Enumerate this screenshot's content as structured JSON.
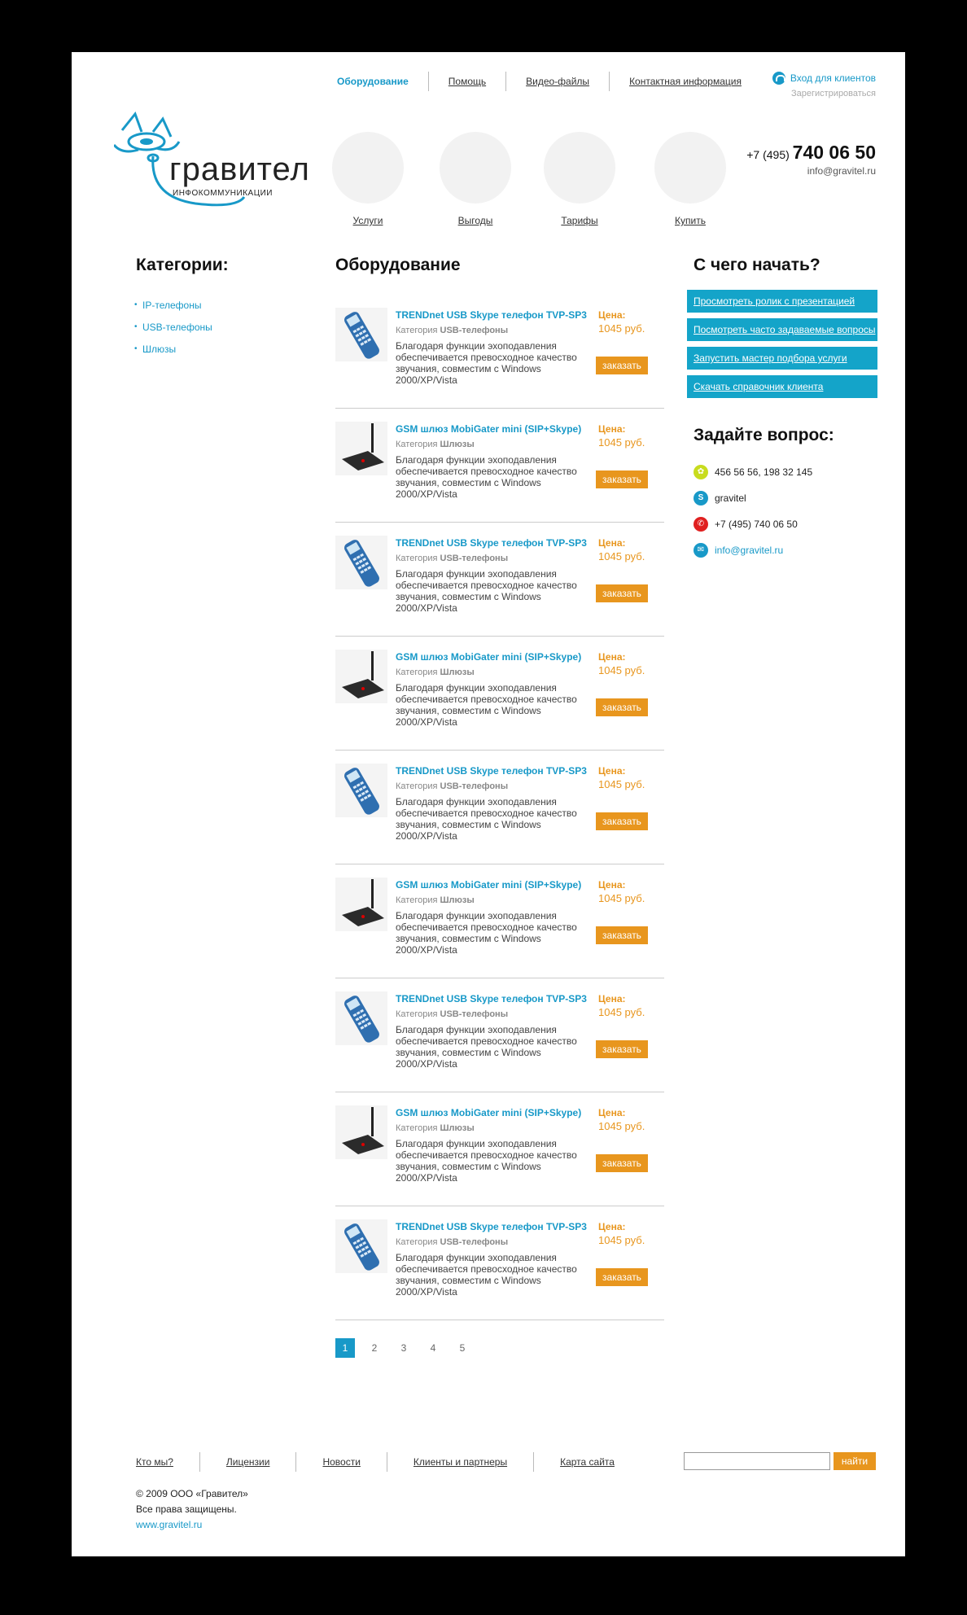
{
  "topnav": {
    "items": [
      "Оборудование",
      "Помощь",
      "Видео-файлы",
      "Контактная информация"
    ]
  },
  "login": {
    "enter": "Вход для клиентов",
    "register": "Зарегистрироваться"
  },
  "logo": {
    "name": "гравител",
    "sub": "ИНФОКОММУНИКАЦИИ"
  },
  "circles": [
    "Услуги",
    "Выгоды",
    "Тарифы",
    "Купить"
  ],
  "phone": {
    "prefix": "+7 (495)",
    "number": "740 06 50",
    "email": "info@gravitel.ru"
  },
  "left": {
    "title": "Категории:",
    "categories": [
      "IP-телефоны",
      "USB-телефоны",
      "Шлюзы"
    ]
  },
  "main": {
    "title": "Оборудование",
    "products": [
      {
        "kind": "phone",
        "title": "TRENDnet USB Skype телефон TVP-SP3",
        "cat_prefix": "Категория",
        "category": "USB-телефоны",
        "desc": "Благодаря функции эхоподавления обеспечивается превосходное качество звучания, совместим с Windows 2000/XP/Vista",
        "price_label": "Цена:",
        "price": "1045 руб.",
        "order": "заказать"
      },
      {
        "kind": "gateway",
        "title": "GSM шлюз MobiGater mini (SIP+Skype)",
        "cat_prefix": "Категория",
        "category": "Шлюзы",
        "desc": "Благодаря функции эхоподавления обеспечивается превосходное качество звучания, совместим с Windows 2000/XP/Vista",
        "price_label": "Цена:",
        "price": "1045 руб.",
        "order": "заказать"
      },
      {
        "kind": "phone",
        "title": "TRENDnet USB Skype телефон TVP-SP3",
        "cat_prefix": "Категория",
        "category": "USB-телефоны",
        "desc": "Благодаря функции эхоподавления обеспечивается превосходное качество звучания, совместим с Windows 2000/XP/Vista",
        "price_label": "Цена:",
        "price": "1045 руб.",
        "order": "заказать"
      },
      {
        "kind": "gateway",
        "title": "GSM шлюз MobiGater mini (SIP+Skype)",
        "cat_prefix": "Категория",
        "category": "Шлюзы",
        "desc": "Благодаря функции эхоподавления обеспечивается превосходное качество звучания, совместим с Windows 2000/XP/Vista",
        "price_label": "Цена:",
        "price": "1045 руб.",
        "order": "заказать"
      },
      {
        "kind": "phone",
        "title": "TRENDnet USB Skype телефон TVP-SP3",
        "cat_prefix": "Категория",
        "category": "USB-телефоны",
        "desc": "Благодаря функции эхоподавления обеспечивается превосходное качество звучания, совместим с Windows 2000/XP/Vista",
        "price_label": "Цена:",
        "price": "1045 руб.",
        "order": "заказать"
      },
      {
        "kind": "gateway",
        "title": "GSM шлюз MobiGater mini (SIP+Skype)",
        "cat_prefix": "Категория",
        "category": "Шлюзы",
        "desc": "Благодаря функции эхоподавления обеспечивается превосходное качество звучания, совместим с Windows 2000/XP/Vista",
        "price_label": "Цена:",
        "price": "1045 руб.",
        "order": "заказать"
      },
      {
        "kind": "phone",
        "title": "TRENDnet USB Skype телефон TVP-SP3",
        "cat_prefix": "Категория",
        "category": "USB-телефоны",
        "desc": "Благодаря функции эхоподавления обеспечивается превосходное качество звучания, совместим с Windows 2000/XP/Vista",
        "price_label": "Цена:",
        "price": "1045 руб.",
        "order": "заказать"
      },
      {
        "kind": "gateway",
        "title": "GSM шлюз MobiGater mini (SIP+Skype)",
        "cat_prefix": "Категория",
        "category": "Шлюзы",
        "desc": "Благодаря функции эхоподавления обеспечивается превосходное качество звучания, совместим с Windows 2000/XP/Vista",
        "price_label": "Цена:",
        "price": "1045 руб.",
        "order": "заказать"
      },
      {
        "kind": "phone",
        "title": "TRENDnet USB Skype телефон TVP-SP3",
        "cat_prefix": "Категория",
        "category": "USB-телефоны",
        "desc": "Благодаря функции эхоподавления обеспечивается превосходное качество звучания, совместим с Windows 2000/XP/Vista",
        "price_label": "Цена:",
        "price": "1045 руб.",
        "order": "заказать"
      }
    ],
    "pages": [
      "1",
      "2",
      "3",
      "4",
      "5"
    ]
  },
  "right": {
    "title": "С чего начать?",
    "buttons": [
      "Просмотреть ролик с презентацией",
      "Посмотреть часто задаваемые вопросы",
      "Запустить мастер подбора услуги",
      "Скачать справочник клиента"
    ],
    "ask_title": "Задайте вопрос:",
    "contacts": [
      {
        "icon": "icq-icon",
        "text": "456 56 56, 198 32 145",
        "color": "#c8dc1e"
      },
      {
        "icon": "skype-icon",
        "text": "gravitel",
        "color": "#1899c8"
      },
      {
        "icon": "phone-icon",
        "text": "+7 (495) 740 06 50",
        "color": "#e02020"
      },
      {
        "icon": "mail-icon",
        "text": "info@gravitel.ru",
        "color": "#1899c8"
      }
    ]
  },
  "footer": {
    "nav": [
      "Кто мы?",
      "Лицензии",
      "Новости",
      "Клиенты и партнеры",
      "Карта сайта"
    ],
    "search_button": "найти",
    "copyright": "© 2009 ООО «Гравител»",
    "rights": "Все права защищены.",
    "site": "www.gravitel.ru"
  },
  "colors": {
    "accent": "#1899c8",
    "orange": "#e8961e"
  }
}
